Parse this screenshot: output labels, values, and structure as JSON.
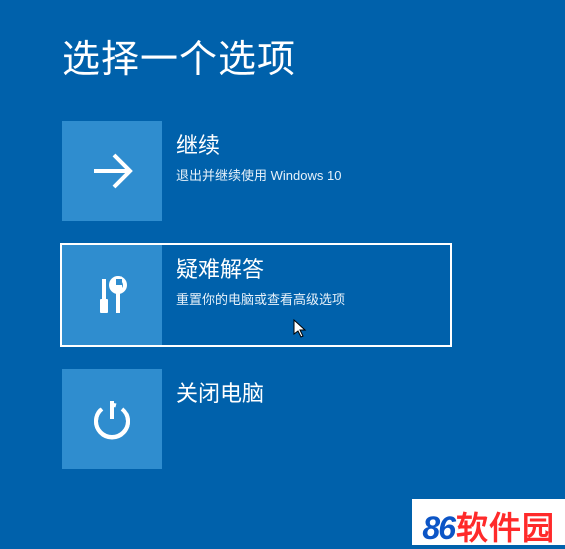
{
  "screen": {
    "title": "选择一个选项"
  },
  "options": [
    {
      "id": "continue",
      "title": "继续",
      "description": "退出并继续使用 Windows 10",
      "icon": "arrow-right-icon",
      "selected": false
    },
    {
      "id": "troubleshoot",
      "title": "疑难解答",
      "description": "重置你的电脑或查看高级选项",
      "icon": "tools-icon",
      "selected": true
    },
    {
      "id": "shutdown",
      "title": "关闭电脑",
      "description": "",
      "icon": "power-icon",
      "selected": false
    }
  ],
  "watermark": {
    "number": "86",
    "text": "软件园"
  },
  "colors": {
    "background": "#0061ab",
    "tile": "#2f8dcf",
    "text": "#ffffff"
  }
}
